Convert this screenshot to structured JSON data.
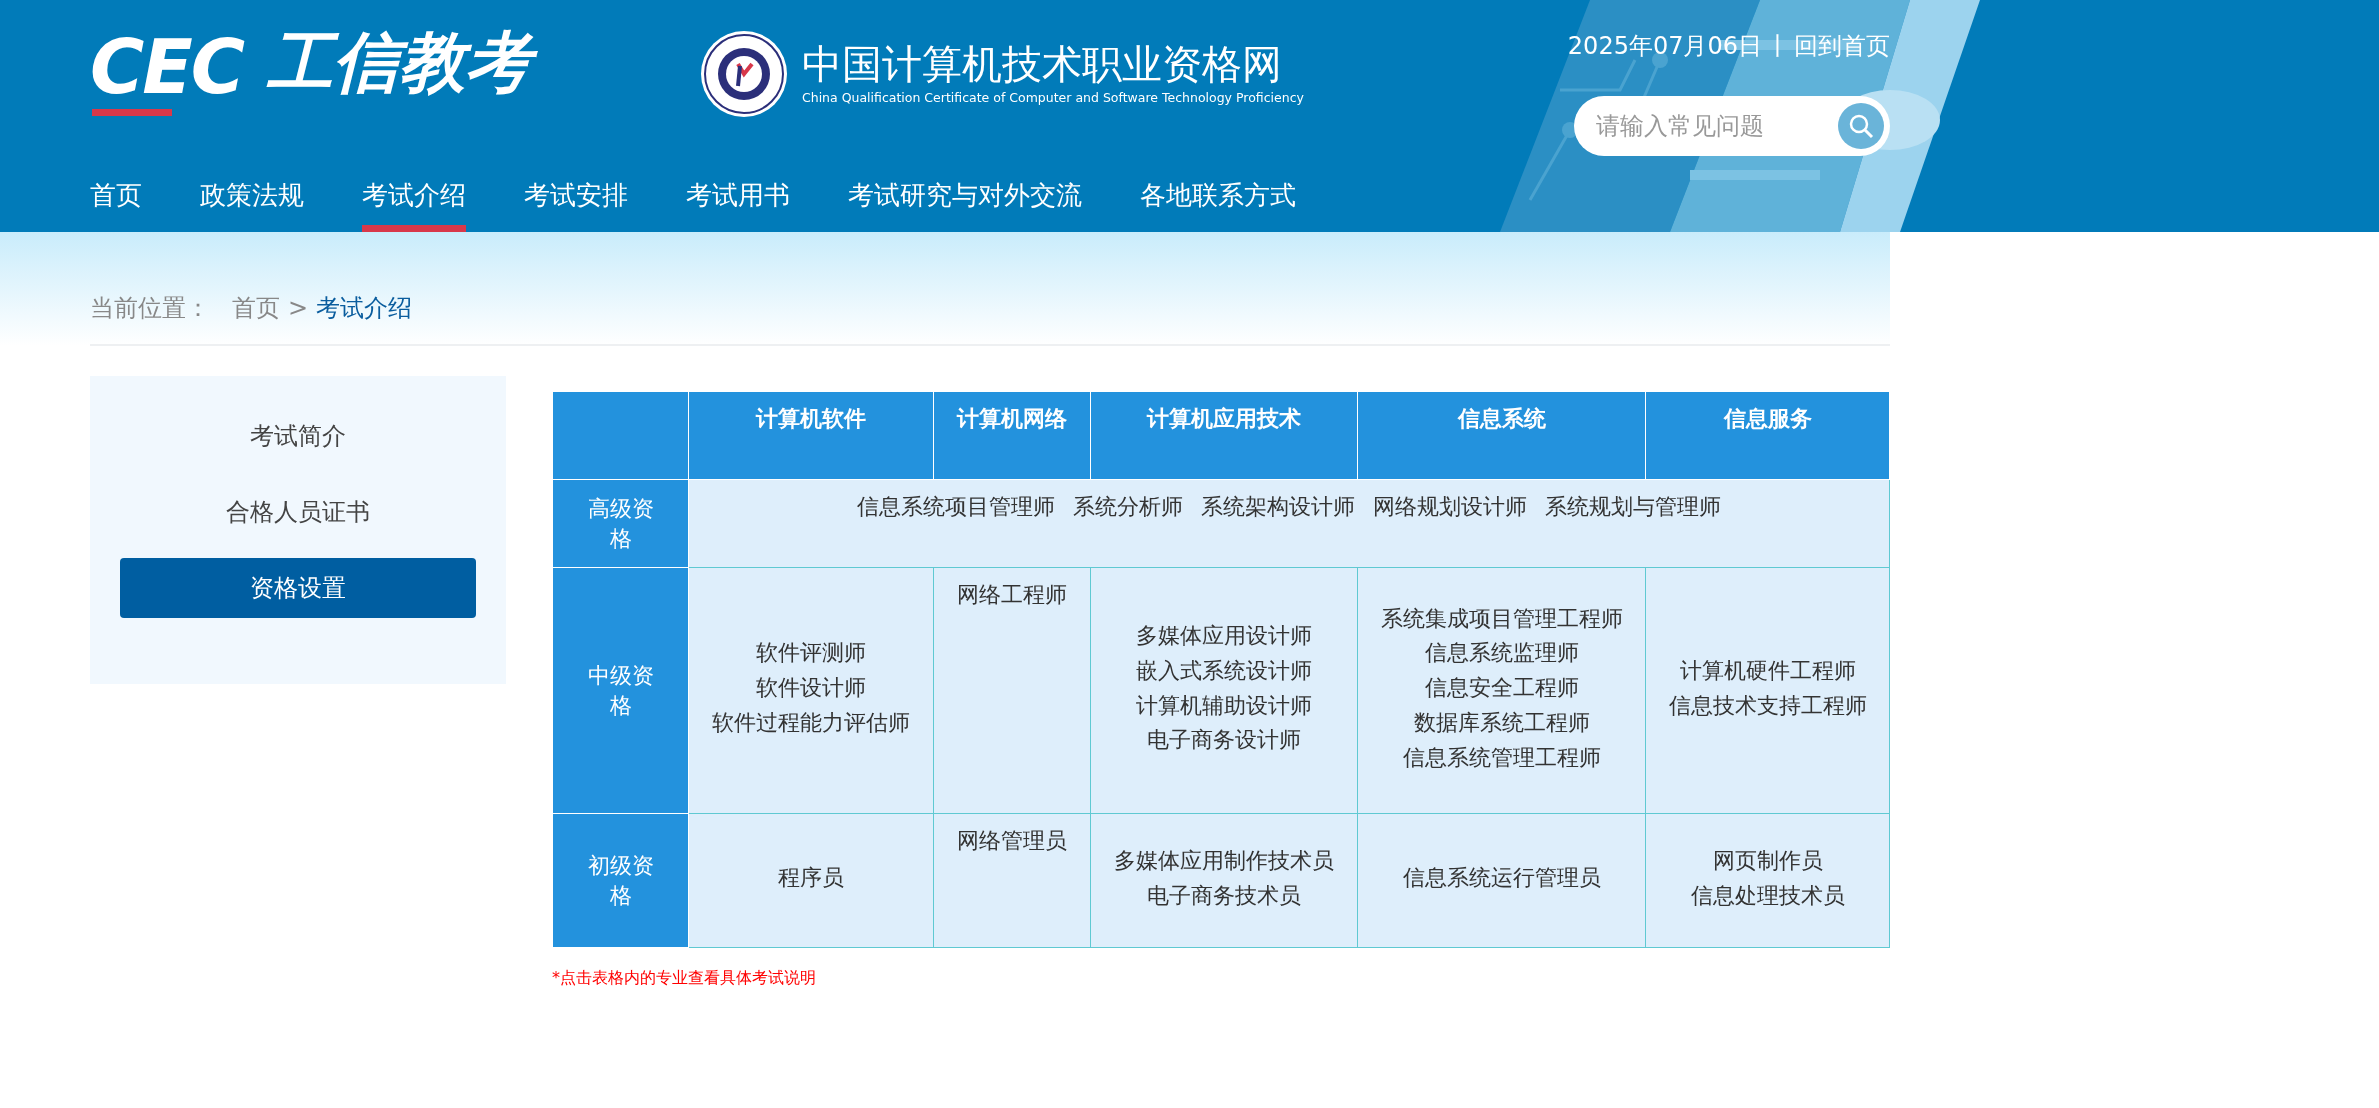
{
  "header": {
    "logo": {
      "mark": "CEC",
      "name": "工信教考"
    },
    "site": {
      "title": "中国计算机技术职业资格网",
      "subtitle": "China Qualification Certificate of Computer and Software Technology Proficiency"
    },
    "date": "2025年07月06日",
    "separator": "丨",
    "home_link": "回到首页",
    "search": {
      "placeholder": "请输入常见问题"
    },
    "nav": [
      {
        "label": "首页",
        "selected": false
      },
      {
        "label": "政策法规",
        "selected": false
      },
      {
        "label": "考试介绍",
        "selected": true
      },
      {
        "label": "考试安排",
        "selected": false
      },
      {
        "label": "考试用书",
        "selected": false
      },
      {
        "label": "考试研究与对外交流",
        "selected": false
      },
      {
        "label": "各地联系方式",
        "selected": false
      }
    ]
  },
  "breadcrumb": {
    "label": "当前位置：",
    "items": [
      "首页",
      "考试介绍"
    ],
    "separator": ">"
  },
  "sidebar": {
    "items": [
      {
        "label": "考试简介",
        "selected": false
      },
      {
        "label": "合格人员证书",
        "selected": false
      },
      {
        "label": "资格设置",
        "selected": true
      }
    ]
  },
  "table": {
    "columns": [
      "计算机软件",
      "计算机网络",
      "计算机应用技术",
      "信息系统",
      "信息服务"
    ],
    "rows": [
      {
        "label": "高级资格",
        "kind": "merged",
        "items": [
          "信息系统项目管理师",
          "系统分析师",
          "系统架构设计师",
          "网络规划设计师",
          "系统规划与管理师"
        ]
      },
      {
        "label": "中级资格",
        "kind": "cells",
        "cells": [
          [
            "软件评测师",
            "软件设计师",
            "软件过程能力评估师"
          ],
          [
            "网络工程师"
          ],
          [
            "多媒体应用设计师",
            "嵌入式系统设计师",
            "计算机辅助设计师",
            "电子商务设计师"
          ],
          [
            "系统集成项目管理工程师",
            "信息系统监理师",
            "信息安全工程师",
            "数据库系统工程师",
            "信息系统管理工程师"
          ],
          [
            "计算机硬件工程师",
            "信息技术支持工程师"
          ]
        ]
      },
      {
        "label": "初级资格",
        "kind": "cells",
        "cells": [
          [
            "程序员"
          ],
          [
            "网络管理员"
          ],
          [
            "多媒体应用制作技术员",
            "电子商务技术员"
          ],
          [
            "信息系统运行管理员"
          ],
          [
            "网页制作员",
            "信息处理技术员"
          ]
        ]
      }
    ]
  },
  "note": "*点击表格内的专业查看具体考试说明"
}
